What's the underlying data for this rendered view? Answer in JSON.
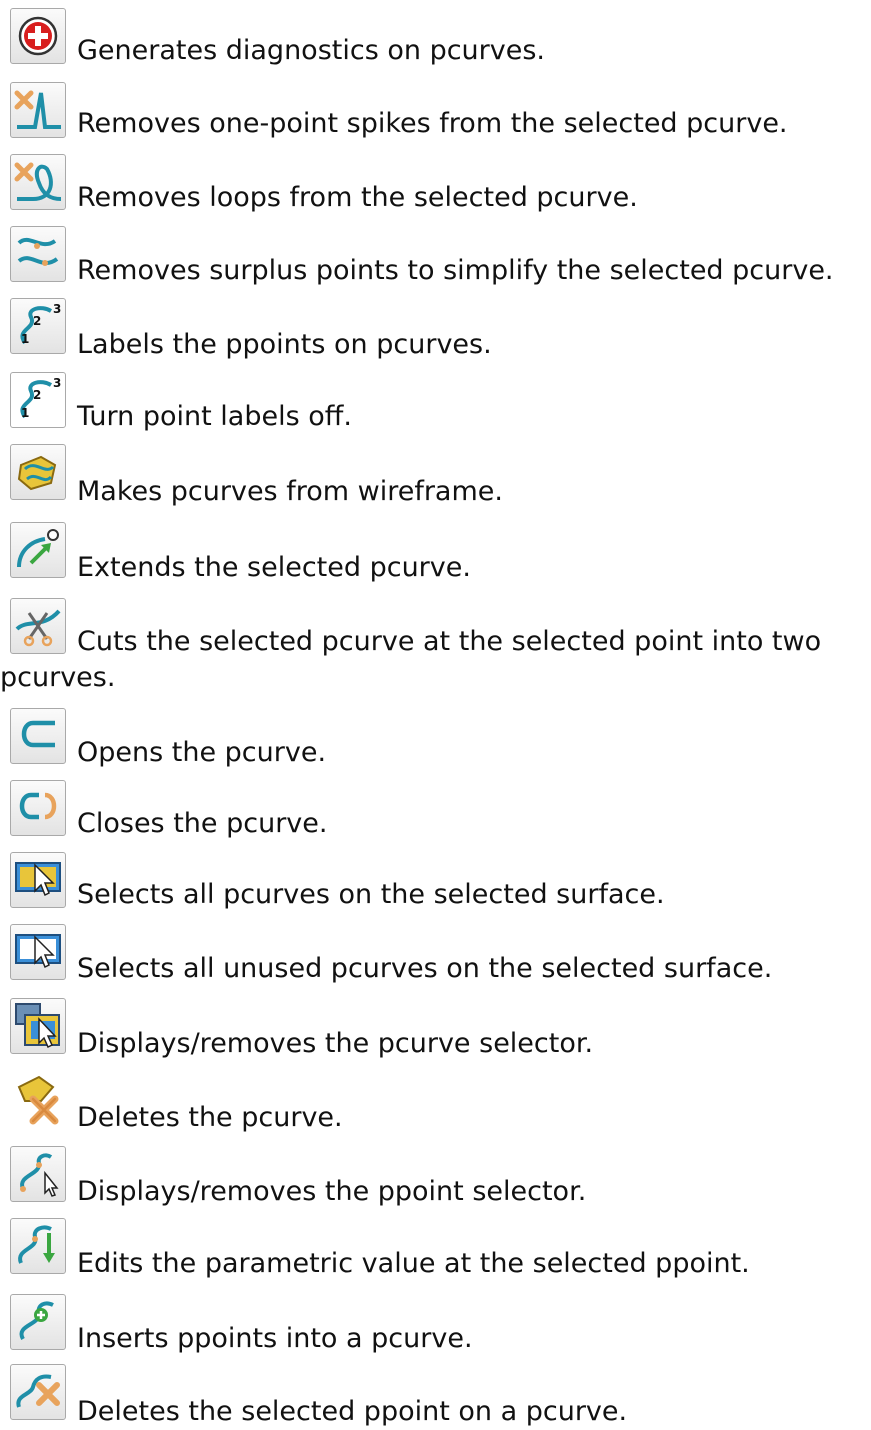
{
  "items": [
    {
      "icon": "diagnostics-icon",
      "text": "Generates diagnostics on pcurves."
    },
    {
      "icon": "remove-spikes-icon",
      "text": "Removes one-point spikes from the selected pcurve."
    },
    {
      "icon": "remove-loops-icon",
      "text": "Removes loops from the selected pcurve."
    },
    {
      "icon": "simplify-icon",
      "text": "Removes surplus points to simplify the selected pcurve."
    },
    {
      "icon": "label-points-on-icon",
      "text": "Labels the ppoints on pcurves."
    },
    {
      "icon": "label-points-off-icon",
      "text": "Turn point labels off."
    },
    {
      "icon": "pcurve-from-wireframe-icon",
      "text": "Makes pcurves from wireframe."
    },
    {
      "icon": "extend-pcurve-icon",
      "text": "Extends the selected pcurve."
    },
    {
      "icon": "cut-pcurve-icon",
      "text": "Cuts the selected pcurve at the selected point into two pcurves."
    },
    {
      "icon": "open-pcurve-icon",
      "text": "Opens the pcurve."
    },
    {
      "icon": "close-pcurve-icon",
      "text": "Closes the pcurve."
    },
    {
      "icon": "select-all-pcurves-icon",
      "text": "Selects all pcurves on the selected surface."
    },
    {
      "icon": "select-unused-pcurves-icon",
      "text": "Selects all unused pcurves on the selected surface."
    },
    {
      "icon": "pcurve-selector-icon",
      "text": "Displays/removes the pcurve selector."
    },
    {
      "icon": "delete-pcurve-icon",
      "text": "Deletes the pcurve."
    },
    {
      "icon": "ppoint-selector-icon",
      "text": "Displays/removes the ppoint selector."
    },
    {
      "icon": "edit-parametric-value-icon",
      "text": "Edits the parametric value at the selected ppoint."
    },
    {
      "icon": "insert-ppoints-icon",
      "text": "Inserts ppoints into a pcurve."
    },
    {
      "icon": "delete-ppoint-icon",
      "text": "Deletes the selected ppoint on a pcurve."
    }
  ],
  "colors": {
    "teal": "#1f8fa8",
    "red": "#d81e1e",
    "orange": "#e8a35c",
    "yellow": "#e8c53a",
    "blue": "#3a6fb5",
    "green": "#3aa640"
  }
}
